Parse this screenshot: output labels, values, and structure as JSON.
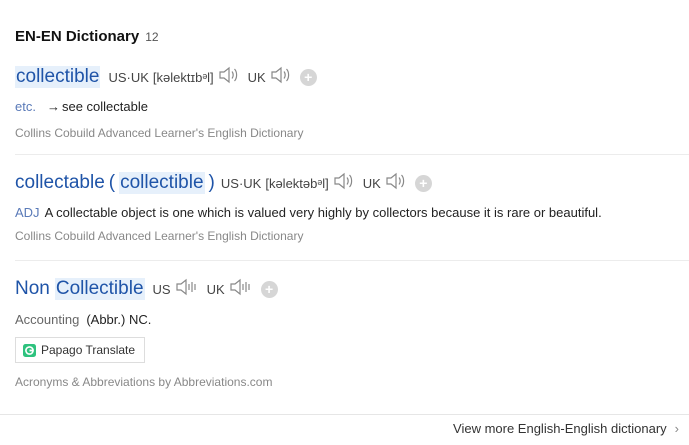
{
  "header": {
    "title": "EN-EN Dictionary",
    "count": "12"
  },
  "entries": [
    {
      "word": "collectible",
      "us_label": "US",
      "uk_label": "UK",
      "pron": "[kəlektɪbᵊl]",
      "uk2_label": "UK",
      "pos": "etc.",
      "arrow": "→",
      "def": "see collectable",
      "source": "Collins Cobuild Advanced Learner's English Dictionary"
    },
    {
      "word_prefix": "collectable",
      "paren_open": "(",
      "word_hl": "collectible",
      "paren_close": ")",
      "us_label": "US",
      "uk_label": "UK",
      "pron": "[kəlektəbᵊl]",
      "uk2_label": "UK",
      "pos": "ADJ",
      "def": "A collectable object is one which is valued very highly by collectors because it is rare or beautiful.",
      "source": "Collins Cobuild Advanced Learner's English Dictionary"
    },
    {
      "word_prefix": "Non",
      "word_hl": "Collectible",
      "us_label": "US",
      "uk_label": "UK",
      "pos": "Accounting",
      "def": "(Abbr.) NC.",
      "papago": "Papago Translate",
      "source": "Acronyms & Abbreviations by Abbreviations.com"
    }
  ],
  "footer": {
    "link": "View more English-English dictionary",
    "chevron": "›"
  },
  "colors": {
    "word": "#1f54a8",
    "highlight": "#e6f0fb",
    "pos": "#5a7ab8",
    "source": "#888888"
  },
  "icons": {
    "speaker": "speaker-icon",
    "plus": "add-icon",
    "papago": "papago-icon",
    "chevron": "chevron-right-icon"
  }
}
